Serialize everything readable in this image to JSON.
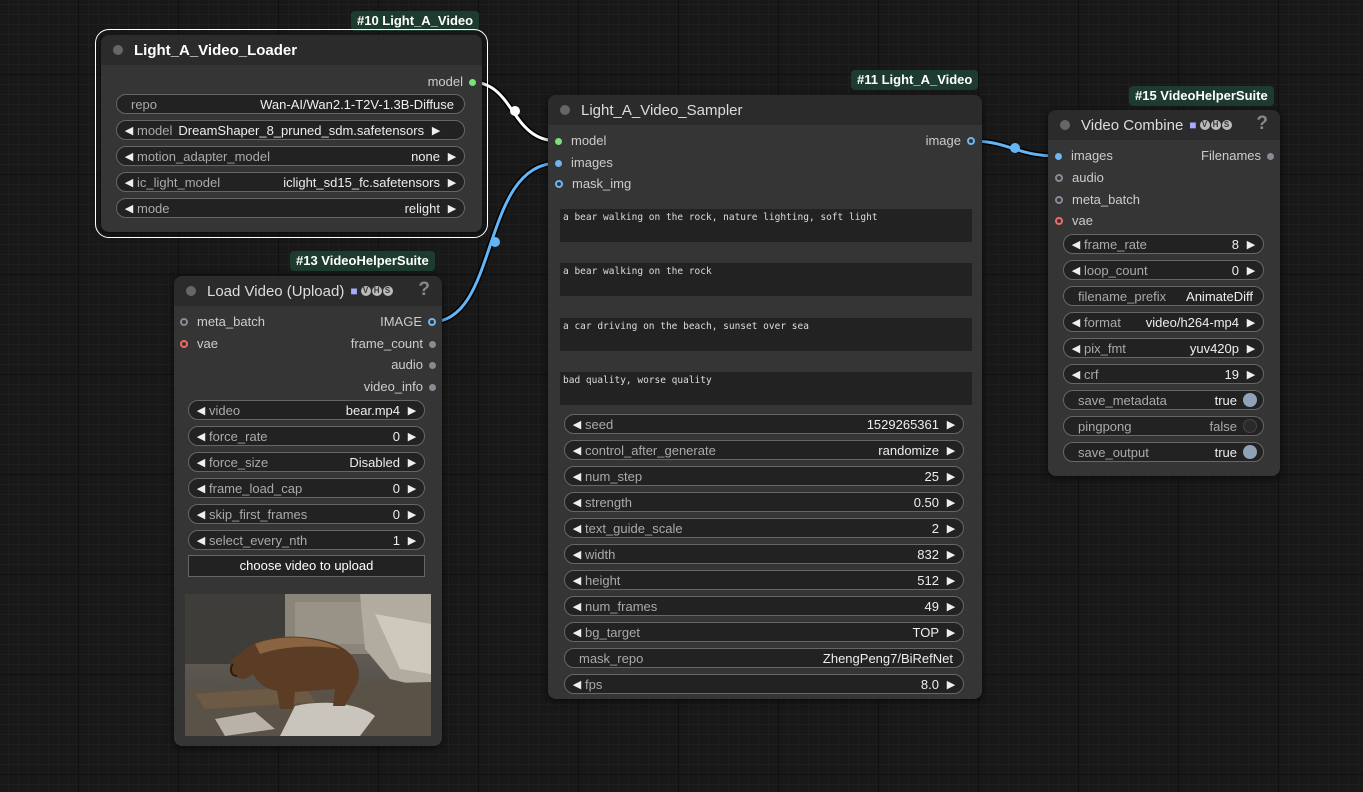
{
  "loader": {
    "badge": "#10 Light_A_Video",
    "title": "Light_A_Video_Loader",
    "output_label": "model",
    "widgets": [
      {
        "label": "repo",
        "value": "Wan-AI/Wan2.1-T2V-1.3B-Diffuse"
      },
      {
        "label": "model",
        "value": "DreamShaper_8_pruned_sdm.safetensors"
      },
      {
        "label": "motion_adapter_model",
        "value": "none"
      },
      {
        "label": "ic_light_model",
        "value": "iclight_sd15_fc.safetensors"
      },
      {
        "label": "mode",
        "value": "relight"
      }
    ]
  },
  "sampler": {
    "badge": "#11 Light_A_Video",
    "title": "Light_A_Video_Sampler",
    "inputs": [
      "model",
      "images",
      "mask_img"
    ],
    "output_label": "image",
    "prompts": [
      "a bear walking on the rock, nature lighting, soft light",
      "a bear walking on the rock",
      "a car driving on the beach, sunset over sea",
      "bad quality, worse quality"
    ],
    "widgets": [
      {
        "label": "seed",
        "value": "1529265361"
      },
      {
        "label": "control_after_generate",
        "value": "randomize"
      },
      {
        "label": "num_step",
        "value": "25"
      },
      {
        "label": "strength",
        "value": "0.50"
      },
      {
        "label": "text_guide_scale",
        "value": "2"
      },
      {
        "label": "width",
        "value": "832"
      },
      {
        "label": "height",
        "value": "512"
      },
      {
        "label": "num_frames",
        "value": "49"
      },
      {
        "label": "bg_target",
        "value": "TOP"
      },
      {
        "label": "mask_repo",
        "value": "ZhengPeng7/BiRefNet"
      },
      {
        "label": "fps",
        "value": "8.0"
      }
    ]
  },
  "load_video": {
    "badge": "#13 VideoHelperSuite",
    "title": "Load Video (Upload)",
    "help": "?",
    "vhs": [
      "V",
      "H",
      "S"
    ],
    "inputs": [
      "meta_batch",
      "vae"
    ],
    "outputs": [
      "IMAGE",
      "frame_count",
      "audio",
      "video_info"
    ],
    "widgets": [
      {
        "label": "video",
        "value": "bear.mp4"
      },
      {
        "label": "force_rate",
        "value": "0"
      },
      {
        "label": "force_size",
        "value": "Disabled"
      },
      {
        "label": "frame_load_cap",
        "value": "0"
      },
      {
        "label": "skip_first_frames",
        "value": "0"
      },
      {
        "label": "select_every_nth",
        "value": "1"
      }
    ],
    "upload_button": "choose video to upload"
  },
  "combine": {
    "badge": "#15 VideoHelperSuite",
    "title": "Video Combine",
    "help": "?",
    "vhs": [
      "V",
      "H",
      "S"
    ],
    "inputs": [
      "images",
      "audio",
      "meta_batch",
      "vae"
    ],
    "output_label": "Filenames",
    "widgets": [
      {
        "label": "frame_rate",
        "value": "8"
      },
      {
        "label": "loop_count",
        "value": "0"
      },
      {
        "label": "filename_prefix",
        "value": "AnimateDiff"
      },
      {
        "label": "format",
        "value": "video/h264-mp4"
      },
      {
        "label": "pix_fmt",
        "value": "yuv420p"
      },
      {
        "label": "crf",
        "value": "19"
      },
      {
        "label": "save_metadata",
        "value": "true"
      },
      {
        "label": "pingpong",
        "value": "false"
      },
      {
        "label": "save_output",
        "value": "true"
      }
    ]
  },
  "colors": {
    "canvas": "#181818",
    "node_body": "#353535",
    "badge": "#1d3b2e",
    "link_model": "#ffffff",
    "link_image": "#64b5f6"
  }
}
